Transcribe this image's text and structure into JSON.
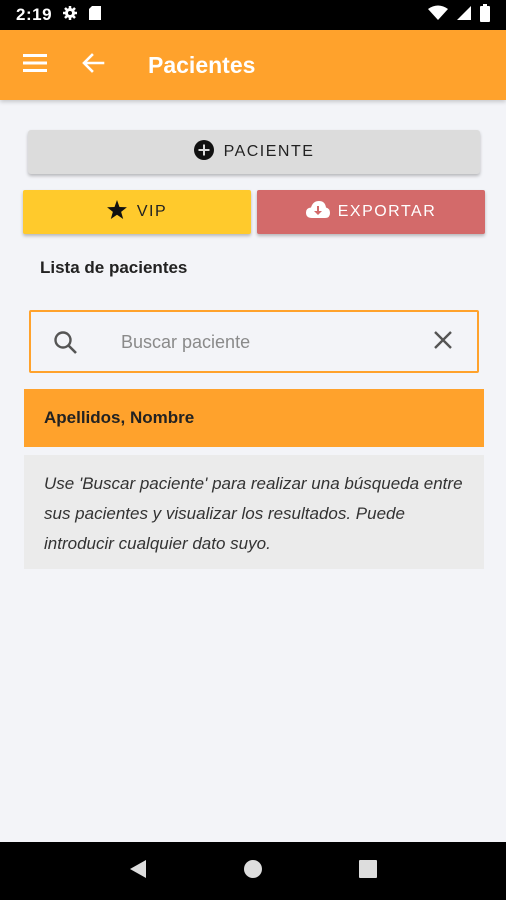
{
  "status_bar": {
    "time": "2:19",
    "icons": [
      "gear-icon",
      "sd-card-icon",
      "wifi-icon",
      "signal-icon",
      "battery-icon"
    ]
  },
  "app_bar": {
    "title": "Pacientes",
    "color": "#ffa22c",
    "icons": [
      "menu-icon",
      "back-arrow-icon"
    ]
  },
  "actions": {
    "add_label": "PACIENTE",
    "vip_label": "VIP",
    "export_label": "EXPORTAR",
    "add_icon": "plus-circle-icon",
    "vip_icon": "star-icon",
    "export_icon": "cloud-download-icon",
    "vip_color": "#ffca2c",
    "export_color": "#d36a6a"
  },
  "list": {
    "title": "Lista de pacientes",
    "search_placeholder": "Buscar paciente",
    "search_value": "",
    "column_header": "Apellidos, Nombre",
    "info_text": "Use 'Buscar paciente' para realizar una búsqueda entre sus pacientes y visualizar los resultados. Puede introducir cualquier dato suyo."
  },
  "nav_bar": {
    "icons": [
      "back-triangle-icon",
      "home-circle-icon",
      "recents-square-icon"
    ]
  }
}
